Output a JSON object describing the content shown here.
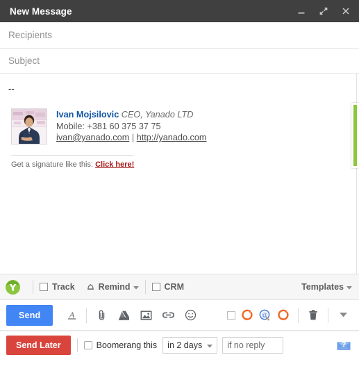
{
  "window": {
    "title": "New Message",
    "controls": {
      "minimize": "minimize",
      "expand": "full-screen",
      "close": "close"
    }
  },
  "compose": {
    "recipients_placeholder": "Recipients",
    "subject_placeholder": "Subject",
    "recipients_value": "",
    "subject_value": ""
  },
  "body": {
    "signature_separator": "--",
    "signature": {
      "name": "Ivan Mojsilovic",
      "role": "CEO, Yanado LTD",
      "mobile": "Mobile: +381 60 375 37 75",
      "email": "ivan@yanado.com",
      "separator": "|",
      "website": "http://yanado.com"
    },
    "footer": {
      "text": "Get a signature like this:",
      "link": "Click here!"
    }
  },
  "plugin_bar": {
    "logo": "yesware-logo",
    "track_label": "Track",
    "track_checked": false,
    "remind_label": "Remind",
    "crm_label": "CRM",
    "crm_checked": false,
    "templates_label": "Templates"
  },
  "gmail_toolbar": {
    "send_label": "Send",
    "icons": [
      "format-text-icon",
      "attach-file-icon",
      "insert-drive-icon",
      "insert-photo-icon",
      "insert-link-icon",
      "insert-emoji-icon"
    ],
    "plugin_icons": [
      "tracking-checkbox",
      "orange-spinner-icon",
      "mail-merge-icon",
      "orange-spinner-icon-2"
    ],
    "discard_icon": "trash-icon",
    "more_options_icon": "chevron-down-icon"
  },
  "boomerang_bar": {
    "send_later_label": "Send Later",
    "boomerang_label": "Boomerang this",
    "boomerang_checked": false,
    "delay_value": "in 2 days",
    "condition_placeholder": "if no reply",
    "condition_value": "",
    "help_icon": "help-envelope-icon"
  },
  "colors": {
    "titlebar_bg": "#404040",
    "send_blue": "#4285f4",
    "send_later_red": "#d9453c",
    "accent_green": "#8cc63e",
    "spinner_orange": "#f26522",
    "link_blue": "#1155a3",
    "link_red": "#a61818"
  }
}
